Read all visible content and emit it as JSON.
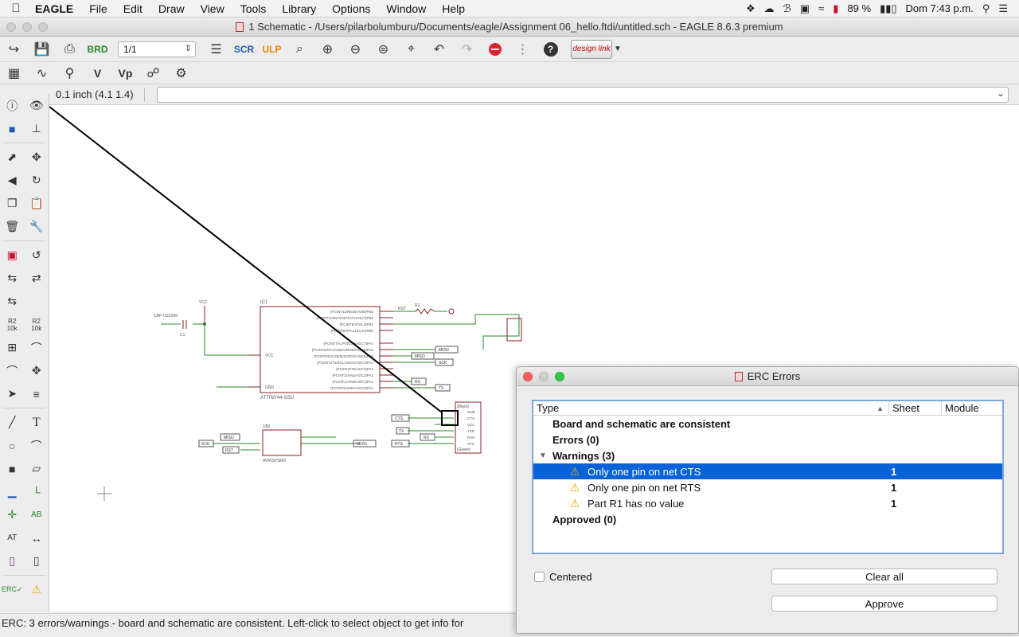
{
  "menubar": {
    "app": "EAGLE",
    "items": [
      "File",
      "Edit",
      "Draw",
      "View",
      "Tools",
      "Library",
      "Options",
      "Window",
      "Help"
    ],
    "battery": "89 %",
    "clock": "Dom 7:43 p.m."
  },
  "window": {
    "title": "1 Schematic - /Users/pilarbolumburu/Documents/eagle/Assignment 06_hello.ftdi/untitled.sch - EAGLE 8.6.3 premium"
  },
  "toolbar": {
    "sheet": "1/1",
    "design_link": "design link"
  },
  "coord": {
    "grid": "0.1 inch (4.1 1.4)"
  },
  "palette": {
    "r2_label": "R2",
    "r2_sub": "10k",
    "text_tool": "T"
  },
  "schematic": {
    "ic1_name": "IC1",
    "ic1_part": "ATTINY44-SSU",
    "vcc": "VCC",
    "gnd": "GND",
    "cap": "CAP-US1206",
    "c1": "C1",
    "r1": "R1",
    "rst": "RST",
    "miso": "MISO",
    "mosi": "MOSI",
    "sck": "SCK",
    "rx": "RX",
    "tx": "TX",
    "cts": "CTS",
    "rts": "RTS",
    "ftdi_black": "(Black)",
    "ftdi_green": "(Green)",
    "avr_name": "U$3",
    "avr_part": "AVRISPSMD",
    "ic1_pins": [
      "(PCINT11/RESET/dW)PB3",
      "(PCINT8/XTAL1/CLKI)PB0",
      "(PCINT9/XTAL2)PB1",
      "(PCINT10/INT0/OC0A/CKOUT)PB2",
      "(PCINT7/ICP/OC0B/ADC7)PA7",
      "(PCINT6/OC1A/SDA/MOSI/ADC6)PA6",
      "(PCINT5/OC1B/MISO/DO/ADC5)PA5",
      "(PCINT4/T1/SCL/USCK/ADC4)PA4",
      "(PCINT3/T0/ADC3)PA3",
      "(PCINT2/AIN1/ADC2)PA2",
      "(PCINT1/AIN0/ADC1)PA1",
      "(PCINT0/AREF/ADC0)PA0"
    ],
    "ftdi_pins": [
      "GND",
      "CTS",
      "VCC",
      "TXD",
      "RXD",
      "RTS"
    ]
  },
  "status": {
    "text": "ERC: 3 errors/warnings - board and schematic are consistent. Left-click to select object to get info for"
  },
  "erc": {
    "title": "ERC Errors",
    "columns": {
      "type": "Type",
      "sheet": "Sheet",
      "module": "Module"
    },
    "rows": {
      "consistent": "Board and schematic are consistent",
      "errors": "Errors (0)",
      "warnings": "Warnings (3)",
      "w1": "Only one pin on net CTS",
      "w1_sheet": "1",
      "w2": "Only one pin on net RTS",
      "w2_sheet": "1",
      "w3": "Part R1 has no value",
      "w3_sheet": "1",
      "approved": "Approved (0)"
    },
    "centered_label": "Centered",
    "clear_all": "Clear all",
    "approve": "Approve"
  },
  "colors": {
    "selection": "#0962d8",
    "part_outline": "#8a1f1f",
    "net": "#2a8a2a"
  }
}
